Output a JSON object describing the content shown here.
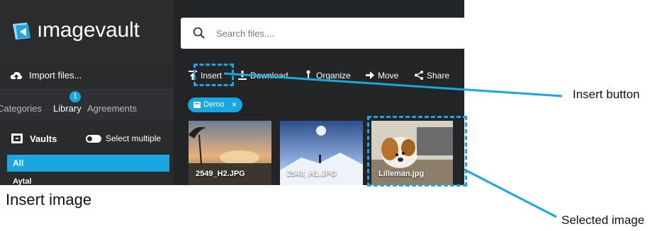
{
  "app": {
    "logo_text": "ımagevault",
    "search": {
      "placeholder": "Search files...."
    }
  },
  "sidebar": {
    "import_label": "Import files...",
    "tabs": [
      {
        "label": "Categories",
        "active": false
      },
      {
        "label": "Library",
        "active": true,
        "badge": "1"
      },
      {
        "label": "Agreements",
        "active": false
      }
    ],
    "vaults_label": "Vaults",
    "select_multiple_label": "Select multiple",
    "items": [
      {
        "label": "All",
        "selected": true
      },
      {
        "label": "Aytal",
        "selected": false
      }
    ]
  },
  "toolbar": {
    "items": [
      {
        "label": "Insert",
        "icon": "insert-icon"
      },
      {
        "label": "Download",
        "icon": "download-icon"
      },
      {
        "label": "Organize",
        "icon": "organize-icon"
      },
      {
        "label": "Move",
        "icon": "arrow-right-icon"
      },
      {
        "label": "Share",
        "icon": "share-icon"
      }
    ]
  },
  "filter_chip": {
    "label": "Demo",
    "close": "×"
  },
  "images": [
    {
      "name": "2549_H2.JPG"
    },
    {
      "name": "2548_H1.JPG"
    },
    {
      "name": "Lilleman.jpg",
      "selected": true
    }
  ],
  "annotations": {
    "insert_button": "Insert button",
    "selected_image": "Selected image",
    "caption": "Insert image"
  },
  "colors": {
    "accent": "#1aa6e0",
    "app_bg": "#232426",
    "sidebar_bg": "#2a2b2d"
  }
}
